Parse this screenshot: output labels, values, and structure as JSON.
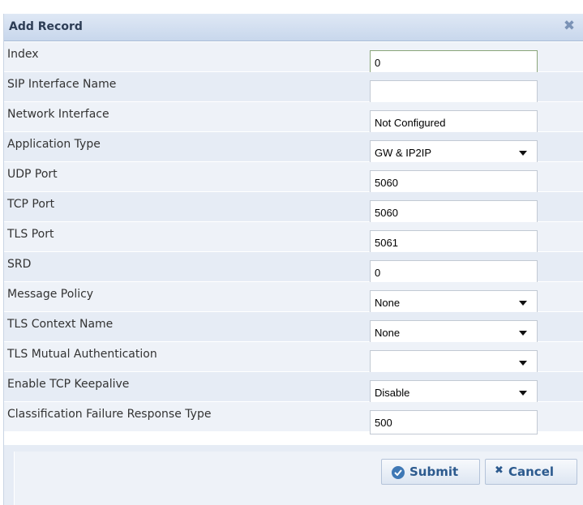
{
  "dialog": {
    "title": "Add Record",
    "close_icon": "close-icon"
  },
  "fields": [
    {
      "label": "Index",
      "value": "0",
      "type": "text",
      "focused": true
    },
    {
      "label": "SIP Interface Name",
      "value": "",
      "type": "text"
    },
    {
      "label": "Network Interface",
      "value": "Not Configured",
      "type": "text"
    },
    {
      "label": "Application Type",
      "value": "GW & IP2IP",
      "type": "select"
    },
    {
      "label": "UDP Port",
      "value": "5060",
      "type": "text"
    },
    {
      "label": "TCP Port",
      "value": "5060",
      "type": "text"
    },
    {
      "label": "TLS Port",
      "value": "5061",
      "type": "text"
    },
    {
      "label": "SRD",
      "value": "0",
      "type": "text"
    },
    {
      "label": "Message Policy",
      "value": "None",
      "type": "select"
    },
    {
      "label": "TLS Context Name",
      "value": "None",
      "type": "select"
    },
    {
      "label": "TLS Mutual Authentication",
      "value": "",
      "type": "select"
    },
    {
      "label": "Enable TCP Keepalive",
      "value": "Disable",
      "type": "select"
    },
    {
      "label": "Classification Failure Response Type",
      "value": "500",
      "type": "text"
    }
  ],
  "buttons": {
    "submit_label": "Submit",
    "cancel_label": "Cancel"
  },
  "colors": {
    "titlebar": "#c8d7ec",
    "row_odd": "#eef2f8",
    "row_even": "#e6ecf5",
    "button_text": "#2c5a8e"
  }
}
